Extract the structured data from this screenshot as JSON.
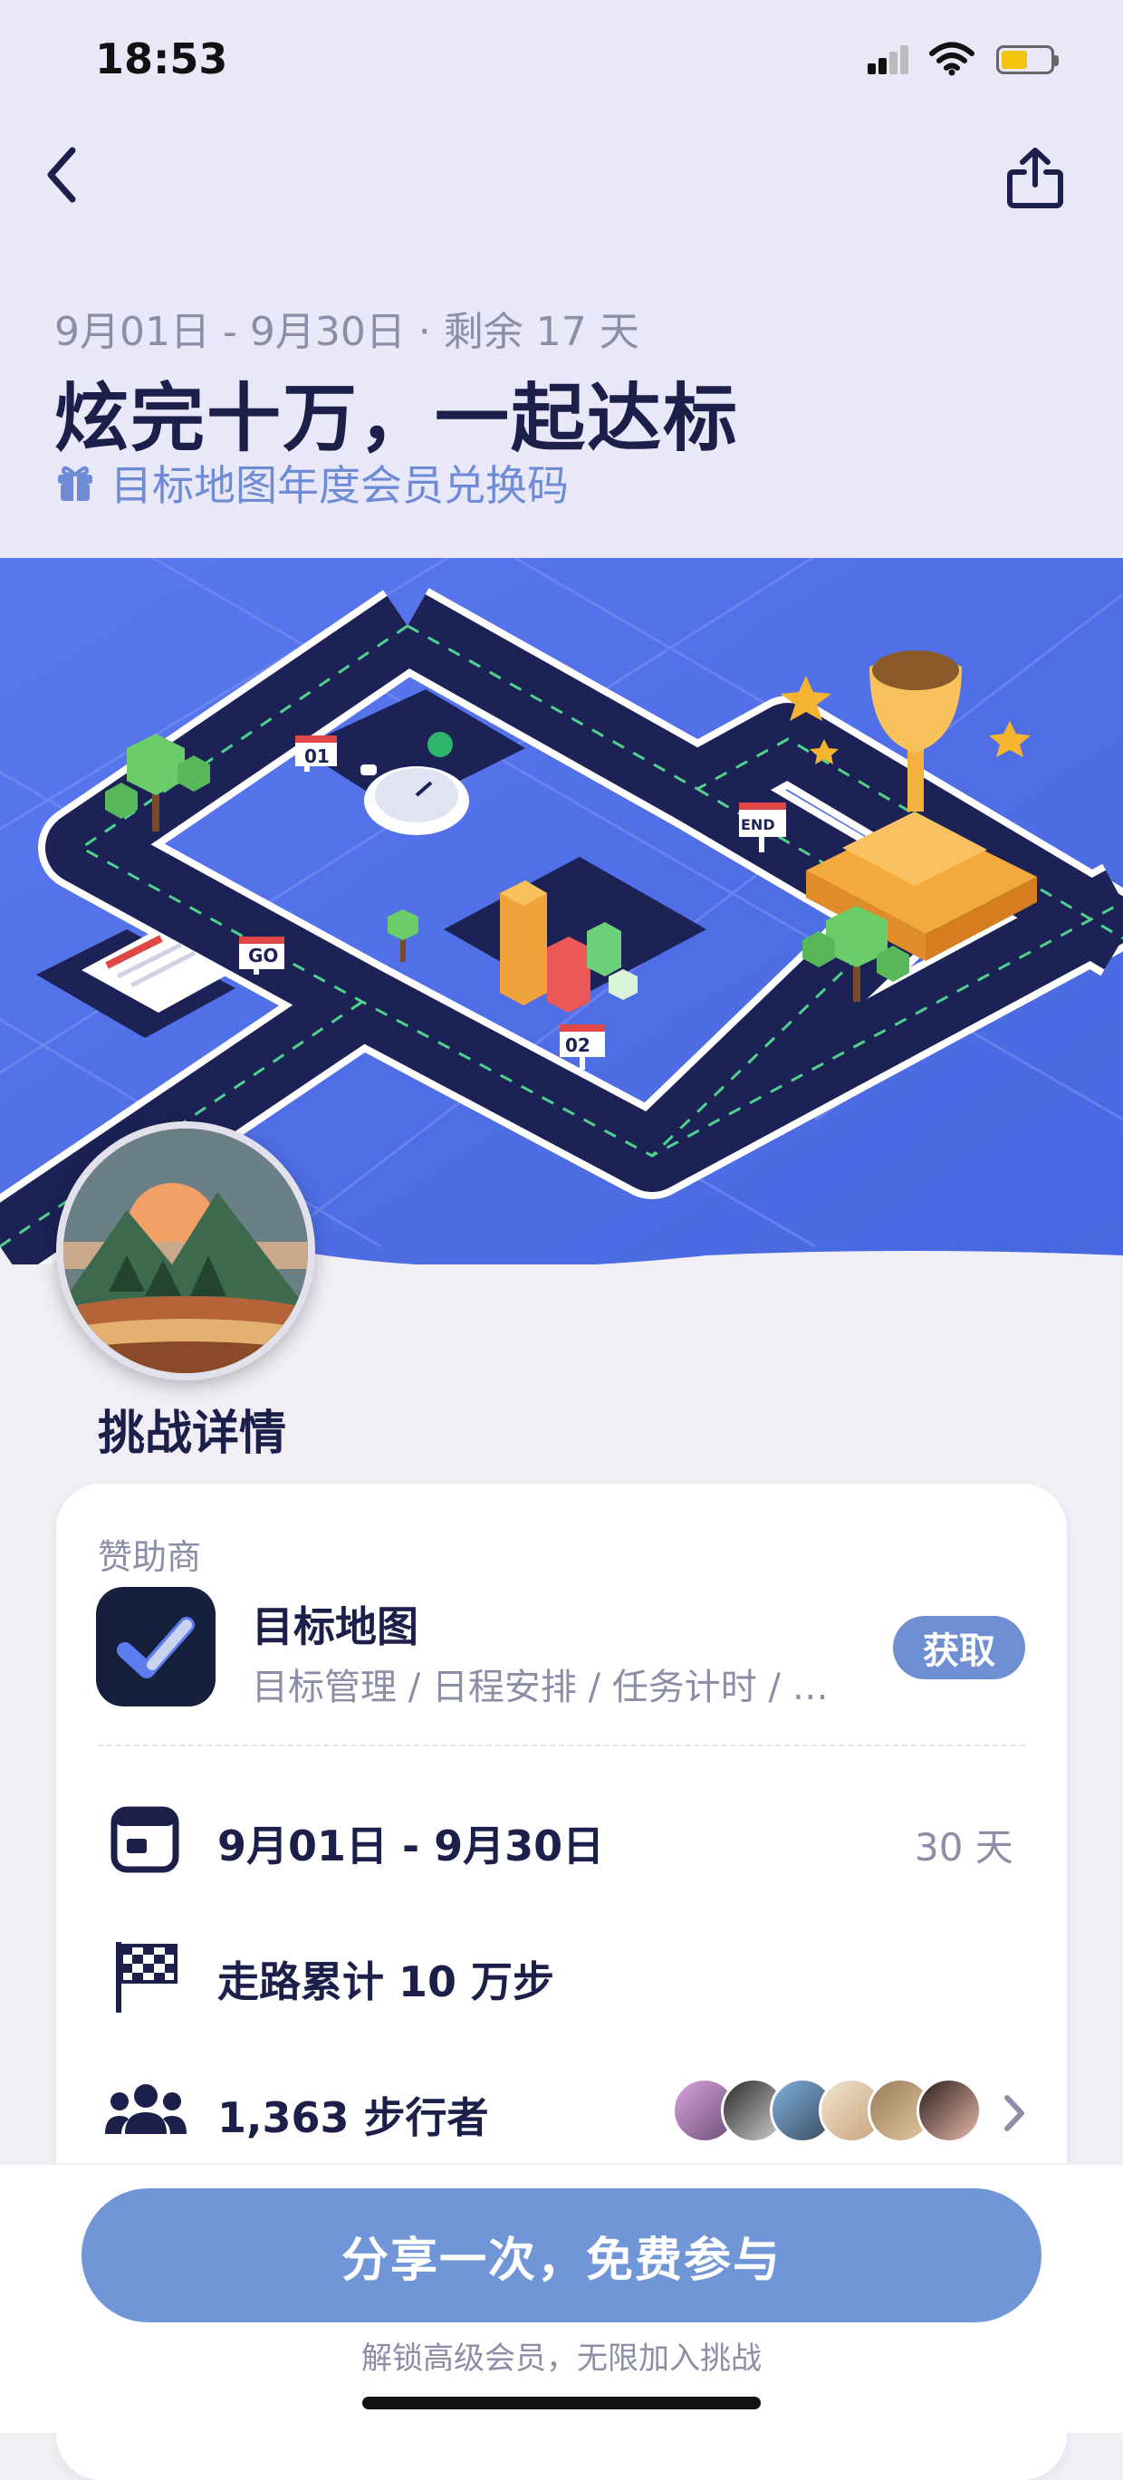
{
  "status_bar": {
    "time": "18:53"
  },
  "header": {
    "date_range": "9月01日 - 9月30日 · 剩余 17 天",
    "title": "炫完十万，一起达标",
    "promo": "目标地图年度会员兑换码"
  },
  "banner": {
    "sign_01": "01",
    "sign_02": "02",
    "sign_go": "GO",
    "sign_end": "END"
  },
  "section_title": "挑战详情",
  "sponsor": {
    "label": "赞助商",
    "app_name": "目标地图",
    "app_desc": "目标管理 / 日程安排 / 任务计时 / …",
    "get_label": "获取"
  },
  "details": {
    "date_range": "9月01日 - 9月30日",
    "duration": "30 天",
    "goal": "走路累计 10 万步",
    "participants": "1,363 步行者"
  },
  "cta": {
    "button": "分享一次，免费参与",
    "note": "解锁高级会员，无限加入挑战"
  },
  "colors": {
    "accent": "#6f8fd4",
    "title": "#1b1f4a",
    "muted": "#8b8ea6",
    "banner_blue": "#4e6de6",
    "road": "#1c2256"
  }
}
